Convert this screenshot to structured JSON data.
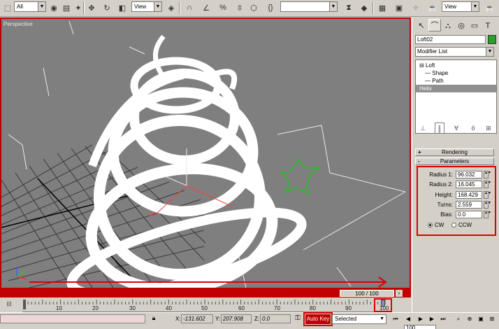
{
  "toolbar": {
    "selection_filter": "All",
    "reference_coord": "View",
    "named_selection": "",
    "render_view": "View",
    "icons": [
      "select-region-icon",
      "select-object-icon",
      "select-by-name-icon",
      "move-icon",
      "rotate-icon",
      "scale-icon",
      "snap-icon",
      "angle-snap-icon",
      "percent-snap-icon",
      "spinner-snap-icon",
      "mirror-icon",
      "align-icon",
      "curve-editor-icon",
      "material-editor-icon",
      "render-scene-icon",
      "quick-render-icon"
    ]
  },
  "viewport": {
    "label": "Perspective",
    "border_color": "#c00000"
  },
  "trackbar": {
    "frame_counter": "100 / 100"
  },
  "timeline": {
    "ticks": [
      "10",
      "20",
      "30",
      "40",
      "50",
      "60",
      "70",
      "80",
      "90",
      "100"
    ]
  },
  "status": {
    "x_label": "X:",
    "x_value": "-131.602",
    "y_label": "Y:",
    "y_value": "207.908",
    "z_label": "Z:",
    "z_value": "0.0",
    "auto_key": "Auto Key",
    "selected": "Selected",
    "frame_value": "100"
  },
  "command_panel": {
    "object_name": "Loft02",
    "object_color": "#2aa02a",
    "modifier_list": "Modifier List",
    "stack": [
      {
        "label": "Loft",
        "indent": 0,
        "selected": false
      },
      {
        "label": "Shape",
        "indent": 1,
        "selected": false
      },
      {
        "label": "Path",
        "indent": 1,
        "selected": false
      },
      {
        "label": "Helix",
        "indent": 0,
        "selected": true
      }
    ],
    "rollouts": {
      "rendering": "Rendering",
      "parameters": "Parameters"
    },
    "parameters": {
      "radius1_label": "Radius 1:",
      "radius1": "96.032",
      "radius2_label": "Radius 2:",
      "radius2": "16.045",
      "height_label": "Height:",
      "height": "168.429",
      "turns_label": "Turns:",
      "turns": "2.559",
      "bias_label": "Bias:",
      "bias": "0.0",
      "cw_label": "CW",
      "ccw_label": "CCW",
      "direction": "CW"
    }
  }
}
